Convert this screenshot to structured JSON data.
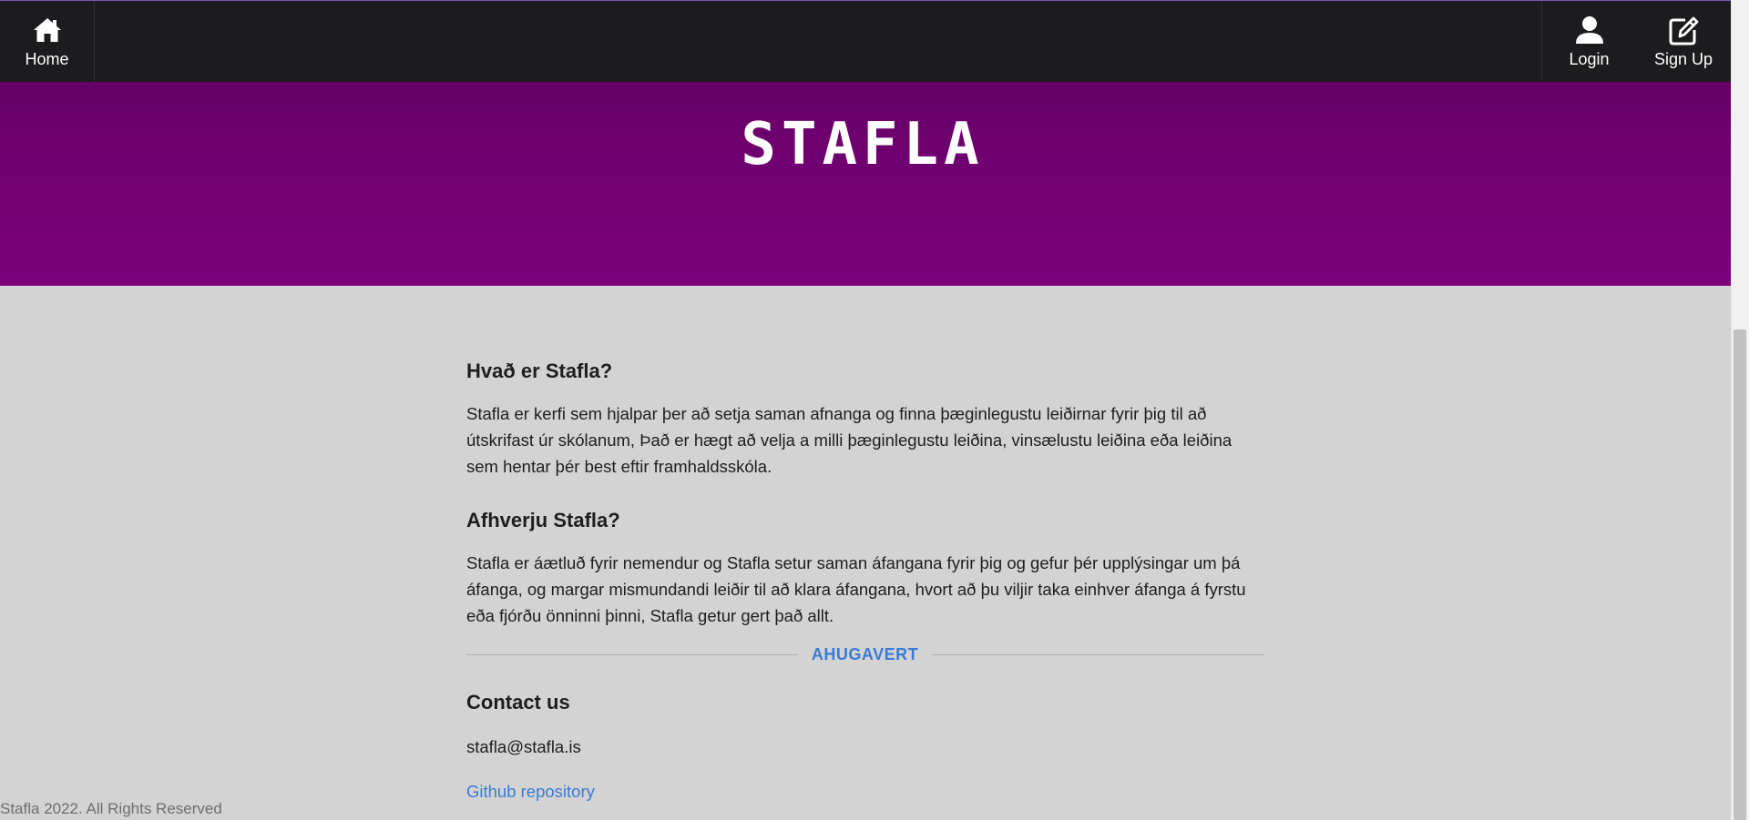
{
  "nav": {
    "home_label": "Home",
    "login_label": "Login",
    "signup_label": "Sign Up"
  },
  "hero": {
    "logo_text": "STAFLA"
  },
  "sections": [
    {
      "title": "Hvað er Stafla?",
      "body": "Stafla er kerfi sem hjalpar þer að setja saman afnanga og finna þæginlegustu leiðirnar fyrir þig til að útskrifast úr skólanum, Það er hægt að velja a milli þæginlegustu leiðina, vinsælustu leiðina eða leiðina sem hentar þér best eftir framhaldsskóla."
    },
    {
      "title": "Afhverju Stafla?",
      "body": "Stafla er áætluð fyrir nemendur og Stafla setur saman áfangana fyrir þig og gefur þér upplýsingar um þá áfanga, og margar mismundandi leiðir til að klara áfangana, hvort að þu viljir taka einhver áfanga á fyrstu eða fjórðu önninni þinni, Stafla getur gert það allt."
    }
  ],
  "divider_label": "AHUGAVERT",
  "contact": {
    "title": "Contact us",
    "email": "stafla@stafla.is",
    "repo_link": "Github repository"
  },
  "footer": {
    "copyright": "Stafla 2022. All Rights Reserved"
  },
  "colors": {
    "nav_bg": "#1c1c1e",
    "hero_top": "#5a0058",
    "hero_bottom": "#7c007c",
    "page_bg": "#d3d3d3",
    "link": "#3a7bd5"
  },
  "icons": {
    "home": "home-icon",
    "login": "user-icon",
    "signup": "edit-icon"
  }
}
